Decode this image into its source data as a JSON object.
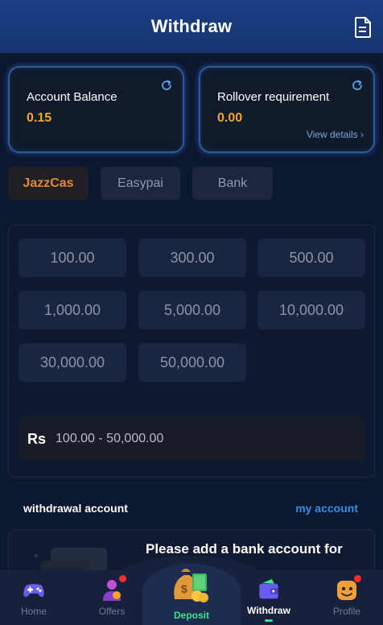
{
  "header": {
    "title": "Withdraw",
    "icon": "document-icon"
  },
  "balance_card": {
    "label": "Account Balance",
    "value": "0.15"
  },
  "rollover_card": {
    "label": "Rollover requirement",
    "value": "0.00",
    "details": "View details ›"
  },
  "methods": [
    {
      "label": "JazzCas",
      "active": true
    },
    {
      "label": "Easypai",
      "active": false
    },
    {
      "label": "Bank",
      "active": false
    }
  ],
  "amounts": [
    "100.00",
    "300.00",
    "500.00",
    "1,000.00",
    "5,000.00",
    "10,000.00",
    "30,000.00",
    "50,000.00"
  ],
  "range": {
    "currency": "Rs",
    "text": "100.00 - 50,000.00"
  },
  "withdrawal_account": {
    "label": "withdrawal account",
    "link": "my account"
  },
  "add_account": {
    "message": "Please add a bank account for withdrawals"
  },
  "nav": {
    "home": "Home",
    "offers": "Offers",
    "deposit": "Deposit",
    "withdraw": "Withdraw",
    "profile": "Profile"
  },
  "colors": {
    "accent_orange": "#f5a623",
    "accent_green": "#3be38a",
    "link_blue": "#2f8fe8",
    "header_blue": "#1a3e86"
  }
}
